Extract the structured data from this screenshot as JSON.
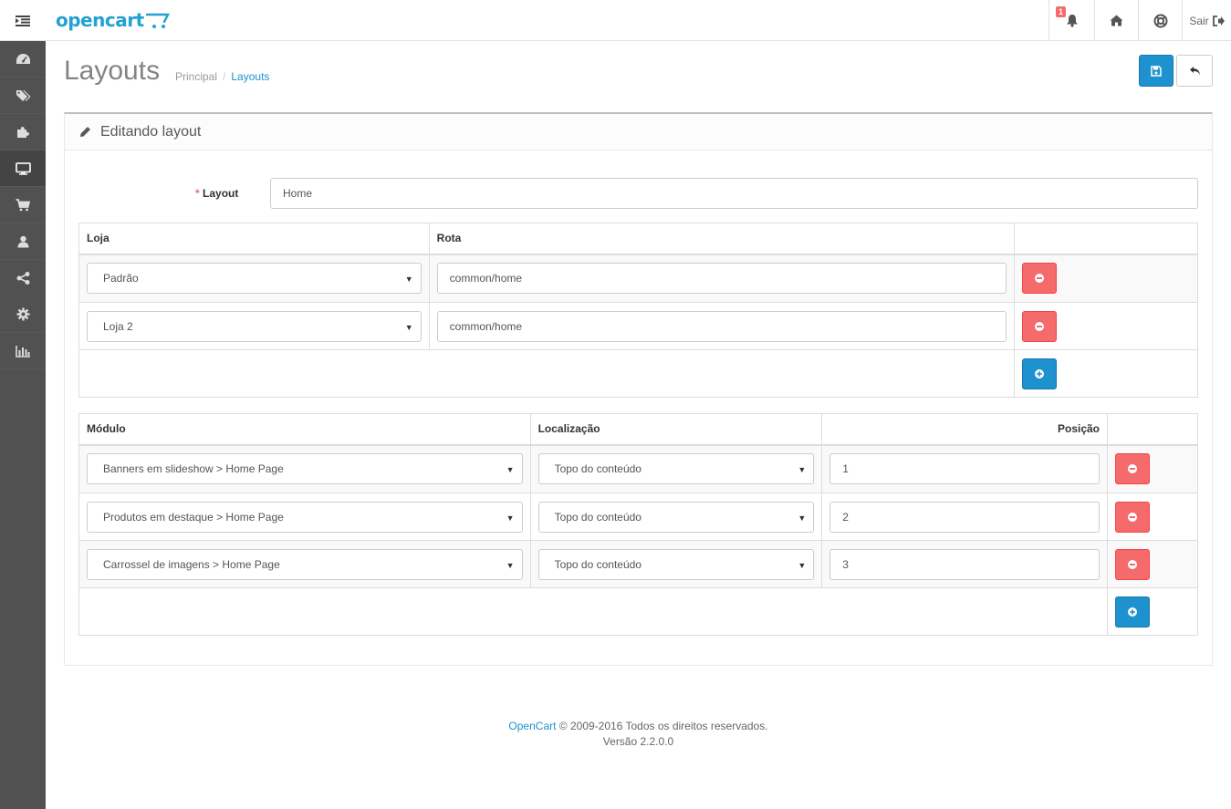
{
  "header": {
    "logo": "opencart",
    "notification_count": "1",
    "logout_label": "Sair"
  },
  "sidebar": {
    "items": [
      {
        "icon": "dashboard-icon"
      },
      {
        "icon": "tags-icon"
      },
      {
        "icon": "puzzle-icon"
      },
      {
        "icon": "desktop-icon",
        "active": true
      },
      {
        "icon": "cart-icon"
      },
      {
        "icon": "user-icon"
      },
      {
        "icon": "share-icon"
      },
      {
        "icon": "gear-icon"
      },
      {
        "icon": "bar-chart-icon"
      }
    ]
  },
  "page": {
    "title": "Layouts",
    "breadcrumb": [
      "Principal",
      "Layouts"
    ],
    "panel_title": "Editando layout"
  },
  "form": {
    "layout_label": "Layout",
    "layout_value": "Home"
  },
  "routes_table": {
    "headers": [
      "Loja",
      "Rota",
      ""
    ],
    "rows": [
      {
        "store": "Padrão",
        "route": "common/home"
      },
      {
        "store": "Loja 2",
        "route": "common/home"
      }
    ]
  },
  "modules_table": {
    "headers": [
      "Módulo",
      "Localização",
      "Posição",
      ""
    ],
    "rows": [
      {
        "module": "Banners em slideshow > Home Page",
        "location": "Topo do conteúdo",
        "position": "1"
      },
      {
        "module": "Produtos em destaque > Home Page",
        "location": "Topo do conteúdo",
        "position": "2"
      },
      {
        "module": "Carrossel de imagens > Home Page",
        "location": "Topo do conteúdo",
        "position": "3"
      }
    ]
  },
  "footer": {
    "brand": "OpenCart",
    "copyright": "© 2009-2016 Todos os direitos reservados.",
    "version": "Versão 2.2.0.0"
  },
  "colors": {
    "primary": "#1e91cf",
    "danger": "#f56b6b",
    "sidebar": "#515151"
  }
}
